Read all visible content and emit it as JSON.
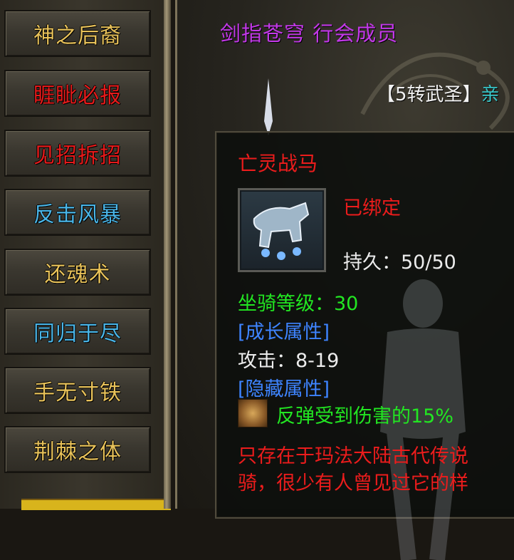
{
  "skills": [
    {
      "label": "神之后裔",
      "color": "#e8c25a"
    },
    {
      "label": "睚眦必报",
      "color": "#e61b1b"
    },
    {
      "label": "见招拆招",
      "color": "#e61b1b"
    },
    {
      "label": "反击风暴",
      "color": "#4ab6e8"
    },
    {
      "label": "还魂术",
      "color": "#e8c25a"
    },
    {
      "label": "同归于尽",
      "color": "#4ab6e8"
    },
    {
      "label": "手无寸铁",
      "color": "#e8c25a"
    },
    {
      "label": "荆棘之体",
      "color": "#e8c25a"
    }
  ],
  "character": {
    "guild_title": "剑指苍穹 行会成员",
    "rank_tag": "【5转武圣】",
    "rank_rest": "亲"
  },
  "tooltip": {
    "item_name": "亡灵战马",
    "bound": "已绑定",
    "durability": "持久：50/50",
    "mount_level": "坐骑等级：30",
    "growth_header": "[成长属性]",
    "attack": "攻击：8-19",
    "hidden_header": "[隐藏属性]",
    "reflect": "反弹受到伤害的15%",
    "lore_line1": "只存在于玛法大陆古代传说",
    "lore_line2": "骑，很少有人曾见过它的样"
  },
  "icons": {
    "item_icon": "undead-horse-icon",
    "buff_icon": "reflect-buff-icon"
  }
}
